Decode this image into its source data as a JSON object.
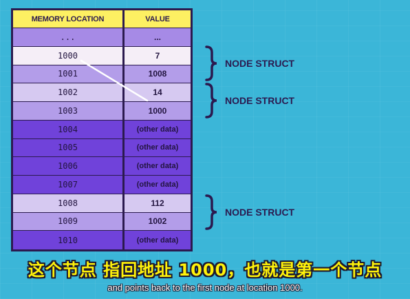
{
  "table": {
    "header": {
      "location": "MEMORY LOCATION",
      "value": "VALUE"
    },
    "rows": [
      {
        "location": "...",
        "value": "...",
        "shade": "lv-ellipsis"
      },
      {
        "location": "1000",
        "value": "7",
        "shade": "lv-white"
      },
      {
        "location": "1001",
        "value": "1008",
        "shade": "lv-light"
      },
      {
        "location": "1002",
        "value": "14",
        "shade": "lv-pale"
      },
      {
        "location": "1003",
        "value": "1000",
        "shade": "lv-light"
      },
      {
        "location": "1004",
        "value": "(other data)",
        "shade": "lv-dark"
      },
      {
        "location": "1005",
        "value": "(other data)",
        "shade": "lv-dark"
      },
      {
        "location": "1006",
        "value": "(other data)",
        "shade": "lv-dark"
      },
      {
        "location": "1007",
        "value": "(other data)",
        "shade": "lv-dark"
      },
      {
        "location": "1008",
        "value": "112",
        "shade": "lv-pale"
      },
      {
        "location": "1009",
        "value": "1002",
        "shade": "lv-light"
      },
      {
        "location": "1010",
        "value": "(other data)",
        "shade": "lv-dark"
      }
    ]
  },
  "annotations": {
    "node1": "NODE STRUCT",
    "node2": "NODE STRUCT",
    "node3": "NODE STRUCT"
  },
  "subtitles": {
    "chinese": "这个节点  指回地址 1000，也就是第一个节点",
    "english": "and points back to the first node at location 1000."
  },
  "colors": {
    "background": "#3bb6d8",
    "header": "#fdf062",
    "border": "#2b1a4f",
    "subtitle_zh": "#fff20a"
  }
}
